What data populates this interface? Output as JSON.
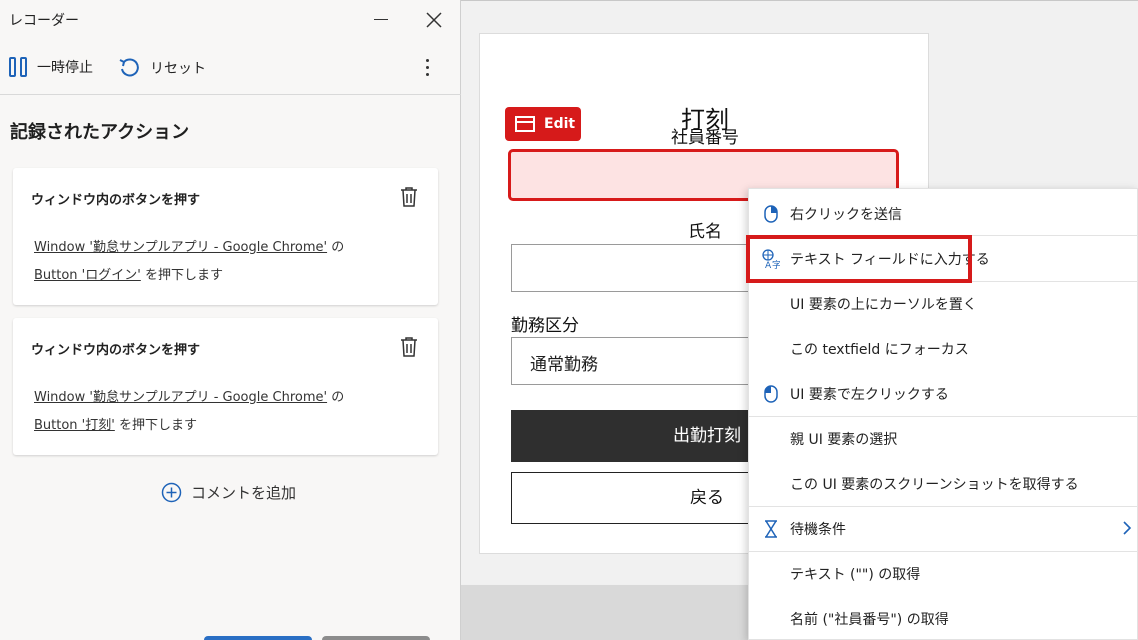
{
  "recorder": {
    "title": "レコーダー",
    "toolbar": {
      "pause_label": "一時停止",
      "reset_label": "リセット"
    },
    "heading": "記録されたアクション",
    "actions": [
      {
        "title": "ウィンドウ内のボタンを押す",
        "window_link": "Window '勤怠サンプルアプリ - Google Chrome'",
        "connector": "の",
        "button_link": "Button 'ログイン'",
        "suffix": "を押下します"
      },
      {
        "title": "ウィンドウ内のボタンを押す",
        "window_link": "Window '勤怠サンプルアプリ - Google Chrome'",
        "connector": "の",
        "button_link": "Button '打刻'",
        "suffix": "を押下します"
      }
    ],
    "add_comment": "コメントを追加"
  },
  "form": {
    "title": "打刻",
    "employee_label": "社員番号",
    "name_label": "氏名",
    "kubun_label": "勤務区分",
    "kubun_value": "通常勤務",
    "clock_in_button": "出勤打刻",
    "back_button": "戻る",
    "edit_badge": "Edit"
  },
  "context_menu": {
    "items": [
      {
        "label": "右クリックを送信",
        "icon": "mouse-right-icon"
      },
      {
        "label": "テキスト フィールドに入力する",
        "icon": "translate-icon",
        "highlighted": true
      },
      {
        "label": "UI 要素の上にカーソルを置く",
        "icon": ""
      },
      {
        "label": "この textfield にフォーカス",
        "icon": ""
      },
      {
        "label": "UI 要素で左クリックする",
        "icon": "mouse-left-icon"
      },
      {
        "label": "親 UI 要素の選択",
        "icon": ""
      },
      {
        "label": "この UI 要素のスクリーンショットを取得する",
        "icon": ""
      },
      {
        "label": "待機条件",
        "icon": "hourglass-icon",
        "submenu": true
      },
      {
        "label": "テキスト (\"\") の取得",
        "icon": ""
      },
      {
        "label": "名前 (\"社員番号\") の取得",
        "icon": ""
      }
    ]
  },
  "colors": {
    "accent": "#1e63b8",
    "highlight": "#d61a1a",
    "primary_button": "#2f2f2f"
  }
}
